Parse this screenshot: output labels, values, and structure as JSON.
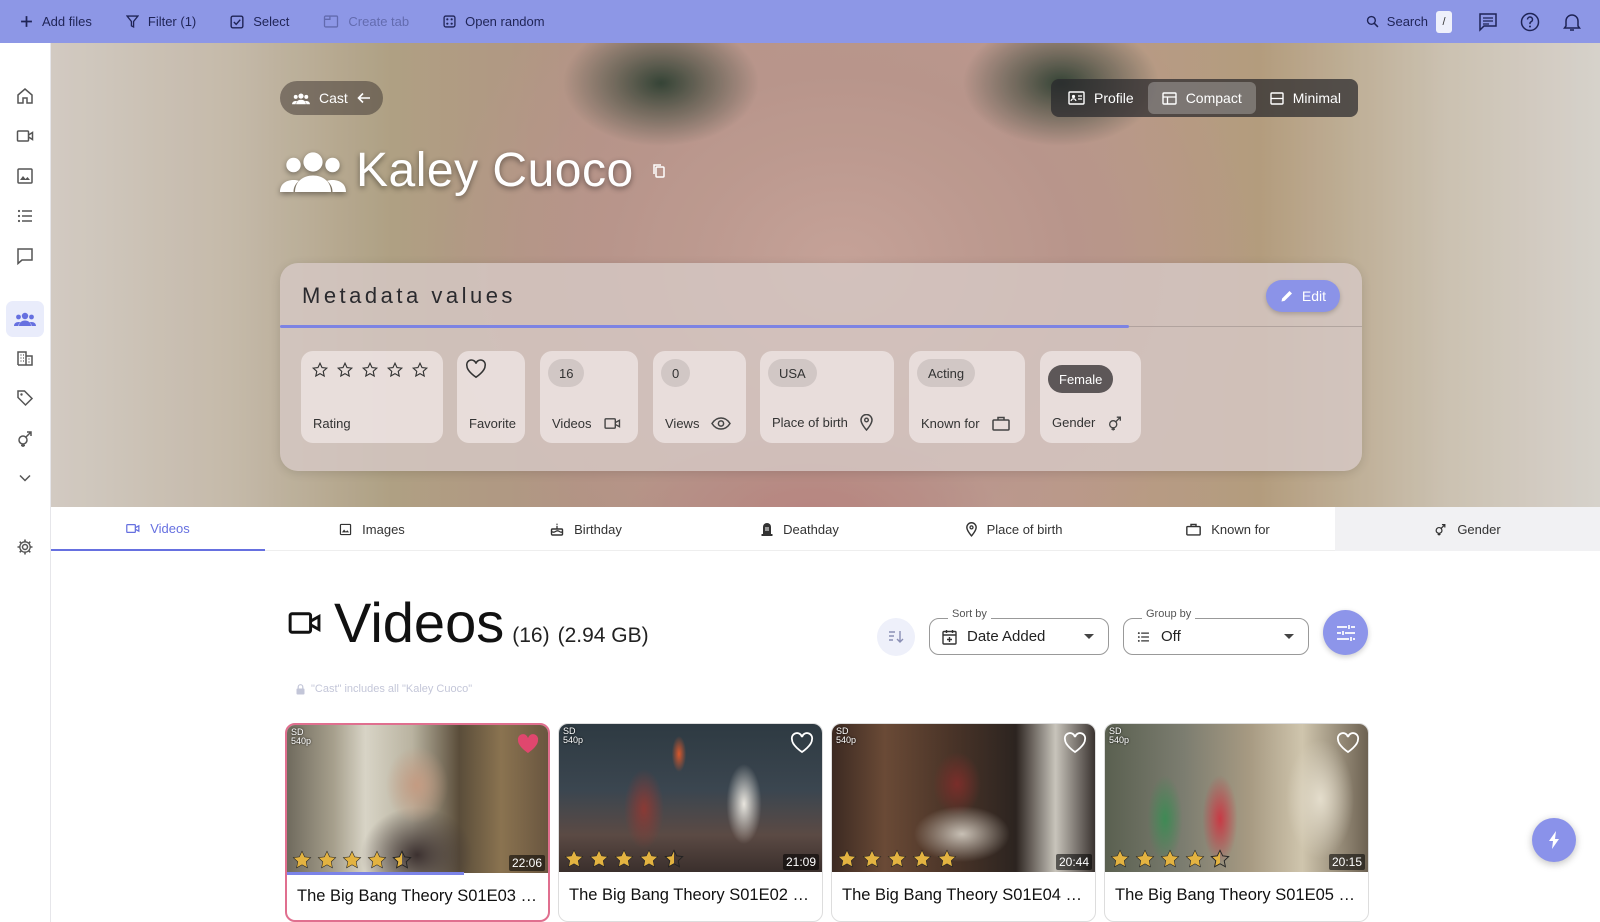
{
  "toolbar": {
    "add_files": "Add files",
    "filter": "Filter (1)",
    "select": "Select",
    "create_tab": "Create tab",
    "open_random": "Open random",
    "search": "Search",
    "search_shortcut": "/"
  },
  "hero": {
    "cast_chip": "Cast",
    "title": "Kaley Cuoco",
    "views": [
      "Profile",
      "Compact",
      "Minimal"
    ],
    "active_view": "Compact"
  },
  "metadata": {
    "heading": "Metadata values",
    "edit_label": "Edit",
    "rating_label": "Rating",
    "favorite_label": "Favorite",
    "videos_value": "16",
    "videos_label": "Videos",
    "views_value": "0",
    "views_label": "Views",
    "place_value": "USA",
    "place_label": "Place of birth",
    "known_value": "Acting",
    "known_label": "Known for",
    "gender_value": "Female",
    "gender_label": "Gender"
  },
  "tabs": [
    "Videos",
    "Images",
    "Birthday",
    "Deathday",
    "Place of birth",
    "Known for",
    "Gender"
  ],
  "videos": {
    "title": "Videos",
    "count": "(16)",
    "size": "(2.94 GB)",
    "sort_caption": "Sort by",
    "sort_value": "Date Added",
    "group_caption": "Group by",
    "group_value": "Off",
    "note": "\"Cast\" includes all \"Kaley Cuoco\""
  },
  "cards": [
    {
      "title": "The Big Bang Theory S01E03 …",
      "duration": "22:06",
      "quality": "SD",
      "res": "540p",
      "rating": 4.5,
      "favorite": true,
      "progress": 0.68
    },
    {
      "title": "The Big Bang Theory S01E02 …",
      "duration": "21:09",
      "quality": "SD",
      "res": "540p",
      "rating": 4.5,
      "favorite": false,
      "progress": 0
    },
    {
      "title": "The Big Bang Theory S01E04 …",
      "duration": "20:44",
      "quality": "SD",
      "res": "540p",
      "rating": 5,
      "favorite": false,
      "progress": 0
    },
    {
      "title": "The Big Bang Theory S01E05 …",
      "duration": "20:15",
      "quality": "SD",
      "res": "540p",
      "rating": 4.5,
      "favorite": false,
      "progress": 0
    }
  ],
  "colors": {
    "accent": "#8d97e6",
    "favorite": "#e0476e",
    "star": "#e3b341"
  }
}
